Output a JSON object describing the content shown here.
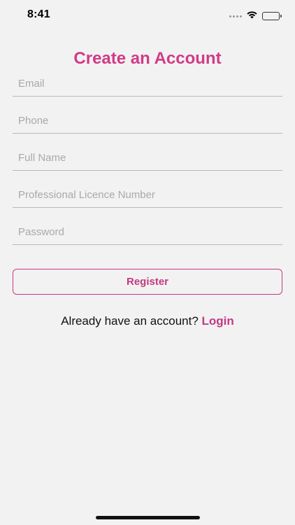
{
  "status_bar": {
    "time": "8:41"
  },
  "title": "Create an Account",
  "fields": {
    "email_placeholder": "Email",
    "phone_placeholder": "Phone",
    "full_name_placeholder": "Full Name",
    "licence_placeholder": "Professional Licence Number",
    "password_placeholder": "Password"
  },
  "register_label": "Register",
  "login_prompt": {
    "text": "Already have an account?",
    "link": "Login"
  },
  "colors": {
    "accent": "#d23a86",
    "background": "#f2f2f2"
  }
}
